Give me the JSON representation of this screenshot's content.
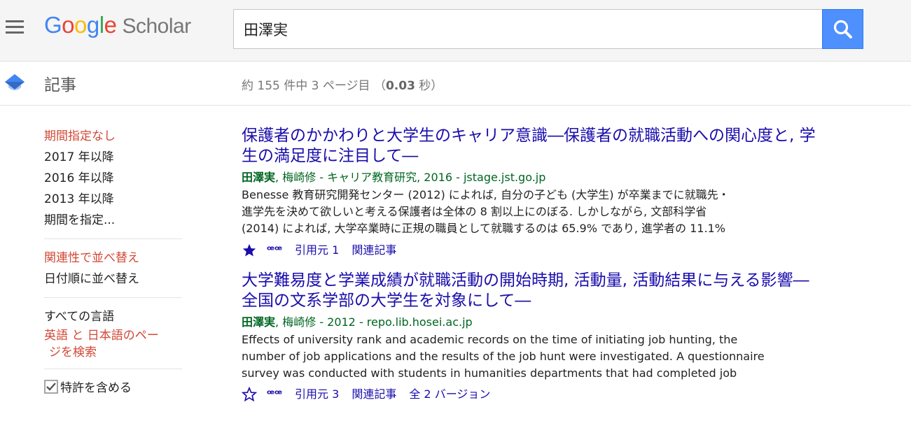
{
  "header": {
    "logo": {
      "G": "G",
      "o1": "o",
      "o2": "o",
      "g": "g",
      "l": "l",
      "e": "e",
      "scholar": "Scholar"
    },
    "search": {
      "value": "田澤実"
    }
  },
  "subbar": {
    "articles_label": "記事",
    "stats_prefix": "約 155 件中 3 ページ目 （",
    "stats_time": "0.03",
    "stats_suffix": " 秒）"
  },
  "sidebar": {
    "time_filters": [
      "期間指定なし",
      "2017 年以降",
      "2016 年以降",
      "2013 年以降",
      "期間を指定..."
    ],
    "sort": [
      "関連性で並べ替え",
      "日付順に並べ替え"
    ],
    "lang_all": "すべての言語",
    "lang_search_line1": "英語 と 日本語のペー",
    "lang_search_line2": "ジを検索",
    "patents": "特許を含める"
  },
  "results": [
    {
      "title_line1": "保護者のかかわりと大学生のキャリア意識―保護者の就職活動への関心度と, 学",
      "title_line2": "生の満足度に注目して―",
      "author_bold": "田澤実",
      "meta_rest": ",  梅崎修 - キャリア教育研究, 2016 - jstage.jst.go.jp",
      "snippet": [
        "Benesse 教育研究開発センター (2012) によれば, 自分の子ども (大学生) が卒業までに就職先・",
        "進学先を決めて欲しいと考える保護者は全体の 8 割以上にのぼる. しかしながら, 文部科学省",
        "(2014) によれば, 大学卒業時に正規の職員として就職するのは 65.9% であり, 進学者の 11.1%"
      ],
      "starred": true,
      "cite_glyph": "ꟹꟹ",
      "cited_by": "引用元 1",
      "related": "関連記事",
      "versions": ""
    },
    {
      "title_line1": "大学難易度と学業成績が就職活動の開始時期, 活動量, 活動結果に与える影響―",
      "title_line2": "全国の文系学部の大学生を対象にして―",
      "author_bold": "田澤実",
      "meta_rest": ",  梅崎修 - 2012 - repo.lib.hosei.ac.jp",
      "snippet": [
        "Effects of university rank and academic records on the time of initiating job hunting, the",
        "number of job applications and the results of the job hunt were investigated. A questionnaire",
        "survey was conducted with students in humanities departments that had completed job"
      ],
      "starred": false,
      "cite_glyph": "ꟹꟹ",
      "cited_by": "引用元 3",
      "related": "関連記事",
      "versions": "全 2 バージョン"
    }
  ],
  "colors": {
    "link": "#1a0dab",
    "green": "#006621",
    "active": "#d14836",
    "search_btn": "#4d90fe"
  }
}
